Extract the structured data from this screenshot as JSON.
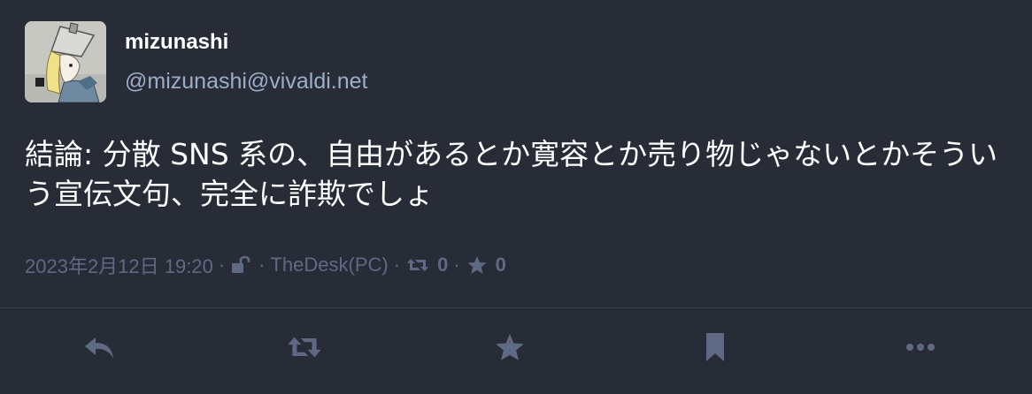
{
  "status": {
    "display_name": "mizunashi",
    "account": "@mizunashi@vivaldi.net",
    "content": "結論: 分散 SNS 系の、自由があるとか寛容とか売り物じゃないとかそういう宣伝文句、完全に詐欺でしょ",
    "timestamp": "2023年2月12日 19:20",
    "visibility_icon": "unlock-icon",
    "application": "TheDesk(PC)",
    "reblog_count": "0",
    "favourite_count": "0"
  },
  "actions": {
    "reply_icon": "reply-icon",
    "boost_icon": "retweet-icon",
    "favourite_icon": "star-icon",
    "bookmark_icon": "bookmark-icon",
    "more_icon": "ellipsis-icon"
  },
  "colors": {
    "background": "#282c37",
    "secondary_text": "#9baec8",
    "meta_text": "#606984",
    "divider": "#393f4f"
  }
}
